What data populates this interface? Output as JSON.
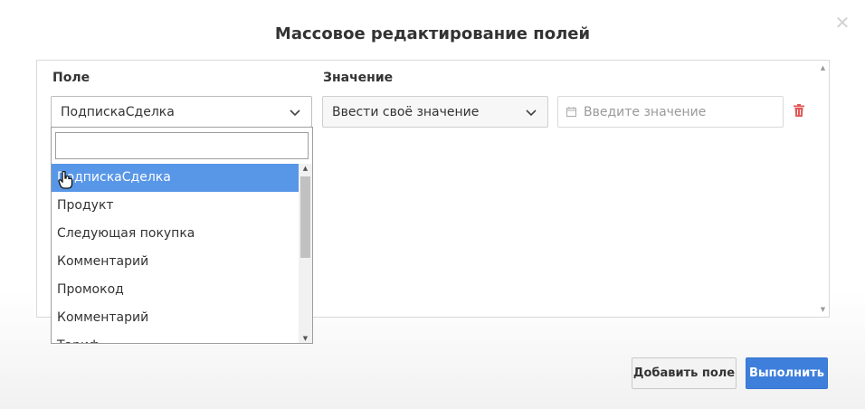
{
  "dialog": {
    "title": "Массовое редактирование полей",
    "close_icon": "close-icon"
  },
  "columns": {
    "field_label": "Поле",
    "value_label": "Значение"
  },
  "row": {
    "field_value": "ПодпискаСделка",
    "value_type": "Ввести своё значение",
    "value_placeholder": "Введите значение",
    "date_icon": "calendar-icon",
    "delete_icon": "trash-icon"
  },
  "dropdown": {
    "search_value": "",
    "items": [
      "ПодпискаСделка",
      "Продукт",
      "Следующая покупка",
      "Комментарий",
      "Промокод",
      "Комментарий",
      "Тариф"
    ],
    "selected_index": 0
  },
  "buttons": {
    "add_field": "Добавить поле",
    "run": "Выполнить"
  },
  "colors": {
    "accent": "#3e7fdc",
    "selected_item": "#5897e8",
    "delete": "#e05a5a"
  }
}
